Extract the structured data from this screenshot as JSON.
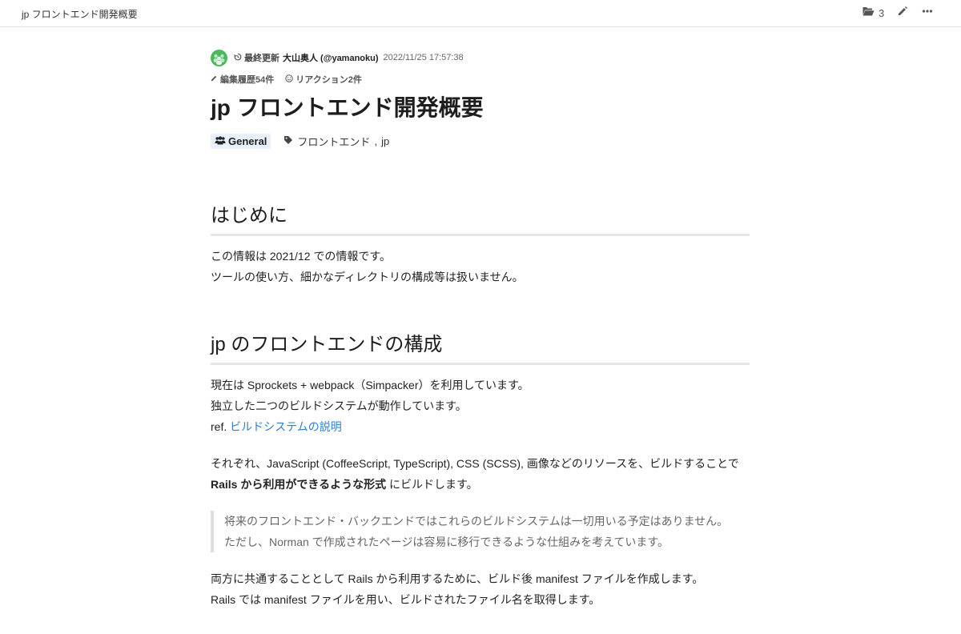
{
  "topbar": {
    "title": "jp フロントエンド開発概要",
    "folder_count": "3"
  },
  "meta": {
    "updated_label": "最終更新",
    "author": "大山奥人 (@yamanoku)",
    "timestamp": "2022/11/25 17:57:38",
    "edit_history": "編集履歴54件",
    "reactions": "リアクション2件"
  },
  "page": {
    "title": "jp フロントエンド開発概要",
    "group": "General",
    "tags": [
      "フロントエンド",
      "jp"
    ]
  },
  "sections": {
    "intro": {
      "heading": "はじめに",
      "lines": [
        "この情報は 2021/12 での情報です。",
        "ツールの使い方、細かなディレクトリの構成等は扱いません。"
      ]
    },
    "composition": {
      "heading": "jp のフロントエンドの構成",
      "lines": [
        "現在は Sprockets + webpack（Simpacker）を利用しています。",
        "独立した二つのビルドシステムが動作しています。"
      ],
      "ref_prefix": "ref.",
      "ref_link": "ビルドシステムの説明",
      "para2_line1": "それぞれ、JavaScript (CoffeeScript, TypeScript), CSS (SCSS), 画像などのリソースを、ビルドすることで",
      "para2_bold": "Rails から利用ができるような形式",
      "para2_tail": " にビルドします。",
      "quote": [
        "将来のフロントエンド・バックエンドではこれらのビルドシステムは一切用いる予定はありません。",
        "ただし、Norman で作成されたページは容易に移行できるような仕組みを考えています。"
      ],
      "para3": [
        "両方に共通することとして Rails から利用するために、ビルド後 manifest ファイルを作成します。",
        "Rails では manifest ファイルを用い、ビルドされたファイル名を取得します。"
      ]
    }
  },
  "icons": {
    "folder": "folder-open-icon",
    "edit": "pencil-icon",
    "more": "ellipsis-icon",
    "history": "history-icon",
    "reaction": "smile-icon",
    "group": "users-icon",
    "tag": "tag-icon"
  },
  "colors": {
    "link": "#2f7ec9",
    "avatar": "#4cb85c",
    "group_badge_bg": "#e8f1fb"
  }
}
